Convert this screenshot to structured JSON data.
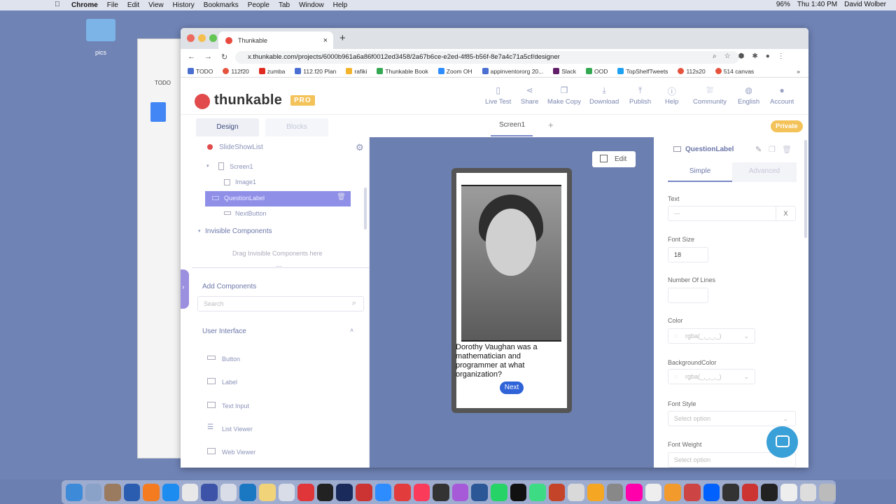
{
  "menubar": {
    "items": [
      "Chrome",
      "File",
      "Edit",
      "View",
      "History",
      "Bookmarks",
      "People",
      "Tab",
      "Window",
      "Help"
    ],
    "battery": "96%",
    "clock": "Thu 1:40 PM",
    "user": "David Wolber"
  },
  "desktop": {
    "folder_label": "pics"
  },
  "bgwindow": {
    "todo": "TODO"
  },
  "browser": {
    "tab_title": "Thunkable",
    "url": "x.thunkable.com/projects/6000b961a6a86f0012ed3458/2a67b6ce-e2ed-4f85-b56f-8e7a4c71a5cf/designer",
    "bookmarks": [
      "TODO",
      "112f20",
      "zumba",
      "112.f20 Plan",
      "rafiki",
      "Thunkable Book",
      "Zoom OH",
      "appinventororg 20...",
      "Slack",
      "OOD",
      "TopShelfTweets",
      "112s20",
      "514 canvas"
    ],
    "bookmarks_more": "»"
  },
  "thunkable": {
    "logo_text": "thunkable",
    "logo_badge": "PRO",
    "nav": [
      {
        "label": "Live Test",
        "icon": "phone-icon"
      },
      {
        "label": "Share",
        "icon": "share-icon"
      },
      {
        "label": "Make Copy",
        "icon": "copy-icon"
      },
      {
        "label": "Download",
        "icon": "download-icon"
      },
      {
        "label": "Publish",
        "icon": "upload-icon"
      },
      {
        "label": "Help",
        "icon": "info-icon"
      },
      {
        "label": "Community",
        "icon": "community-icon"
      },
      {
        "label": "English",
        "icon": "globe-icon"
      },
      {
        "label": "Account",
        "icon": "avatar-icon"
      }
    ],
    "tabs": {
      "design": "Design",
      "blocks": "Blocks"
    },
    "screen_tab": "Screen1",
    "private_badge": "Private",
    "tree": {
      "project": "SlideShowList",
      "screen": "Screen1",
      "components": [
        "Image1",
        "QuestionLabel",
        "NextButton"
      ],
      "invisible_header": "Invisible Components",
      "invisible_hint": "Drag Invisible Components here"
    },
    "add_components": {
      "header": "Add Components",
      "search_placeholder": "Search",
      "category": "User Interface",
      "items": [
        "Button",
        "Label",
        "Text Input",
        "List Viewer",
        "Web Viewer"
      ]
    },
    "canvas": {
      "edit_label": "Edit",
      "question_text": "Dorothy Vaughan was a mathematician and programmer at what organization?",
      "next_label": "Next"
    },
    "properties": {
      "component_name": "QuestionLabel",
      "tabs": {
        "simple": "Simple",
        "advanced": "Advanced"
      },
      "text_label": "Text",
      "text_value": "---",
      "text_clear": "X",
      "font_size_label": "Font Size",
      "font_size_value": "18",
      "lines_label": "Number Of Lines",
      "color_label": "Color",
      "color_value": "rgba(_,_,_,_)",
      "bgcolor_label": "BackgroundColor",
      "bgcolor_value": "rgba(_,_,_,_)",
      "font_style_label": "Font Style",
      "font_style_placeholder": "Select option",
      "font_weight_label": "Font Weight",
      "font_weight_placeholder": "Select option"
    }
  }
}
